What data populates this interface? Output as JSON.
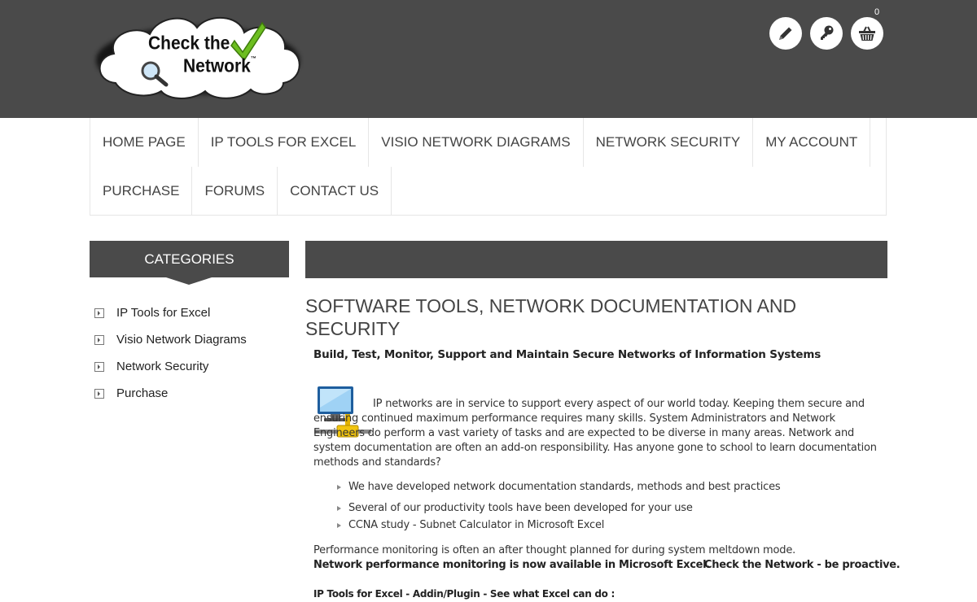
{
  "header": {
    "logo_line1": "Check the",
    "logo_line2": "Network",
    "logo_tm": "™",
    "cart_count": "0",
    "background": "#4a4a4a"
  },
  "nav": {
    "items": [
      {
        "label": "HOME PAGE"
      },
      {
        "label": "IP TOOLS FOR EXCEL"
      },
      {
        "label": "VISIO NETWORK DIAGRAMS"
      },
      {
        "label": "NETWORK SECURITY"
      },
      {
        "label": "MY ACCOUNT"
      },
      {
        "label": "PURCHASE"
      },
      {
        "label": "FORUMS"
      },
      {
        "label": "CONTACT US"
      }
    ]
  },
  "sidebar": {
    "title": "CATEGORIES",
    "items": [
      {
        "label": "IP Tools for Excel"
      },
      {
        "label": "Visio Network Diagrams"
      },
      {
        "label": "Network Security"
      },
      {
        "label": "Purchase"
      }
    ]
  },
  "main": {
    "title": "SOFTWARE TOOLS, NETWORK DOCUMENTATION AND SECURITY",
    "subtitle": "Build, Test, Monitor, Support and Maintain Secure Networks of Information Systems",
    "intro": "IP networks are in service to support every aspect of our world today. Keeping them secure and ensuring continued maximum performance requires many skills. System Administrators and Network Engineers do perform a vast variety of tasks and are expected to be diverse in many areas. Network and system documentation are often an add-on responsibility. Has anyone gone to school to learn documentation methods and standards?",
    "bullets": [
      "We have developed network documentation standards, methods and best practices",
      "Several of our productivity tools have been developed for your use",
      "CCNA study - Subnet Calculator in Microsoft Excel"
    ],
    "perf_line1": "Performance monitoring is often an after thought planned for during system meltdown mode.",
    "perf_line2": "Network performance monitoring is now available in Microsoft Excel.",
    "perf_line3": "Check the Network - be proactive.",
    "ip_tools_heading": "IP Tools for Excel - Addin/Plugin - See what Excel can do :"
  }
}
